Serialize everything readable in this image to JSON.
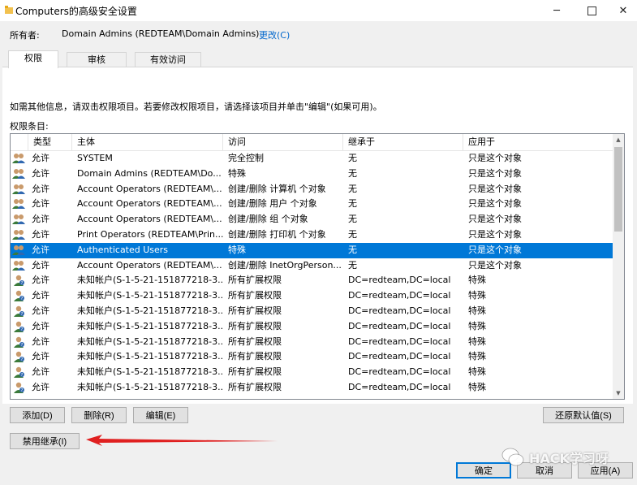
{
  "window": {
    "title": "Computers的高级安全设置",
    "controls": {
      "minimize": "─",
      "close": "✕"
    }
  },
  "owner": {
    "label": "所有者:",
    "value": "Domain Admins (REDTEAM\\Domain Admins)",
    "change_link": "更改(C)"
  },
  "tabs": [
    {
      "label": "权限",
      "active": true
    },
    {
      "label": "审核",
      "active": false
    },
    {
      "label": "有效访问",
      "active": false
    }
  ],
  "instruction": "如需其他信息，请双击权限项目。若要修改权限项目，请选择该项目并单击\"编辑\"(如果可用)。",
  "entries_label": "权限条目:",
  "table": {
    "columns": [
      "类型",
      "主体",
      "访问",
      "继承于",
      "应用于"
    ],
    "rows": [
      {
        "type": "允许",
        "principal": "SYSTEM",
        "access": "完全控制",
        "inherited": "无",
        "applies": "只是这个对象",
        "icon": "group-icon"
      },
      {
        "type": "允许",
        "principal": "Domain Admins (REDTEAM\\Do...",
        "access": "特殊",
        "inherited": "无",
        "applies": "只是这个对象",
        "icon": "group-icon"
      },
      {
        "type": "允许",
        "principal": "Account Operators (REDTEAM\\...",
        "access": "创建/删除 计算机 个对象",
        "inherited": "无",
        "applies": "只是这个对象",
        "icon": "group-icon"
      },
      {
        "type": "允许",
        "principal": "Account Operators (REDTEAM\\...",
        "access": "创建/删除 用户 个对象",
        "inherited": "无",
        "applies": "只是这个对象",
        "icon": "group-icon"
      },
      {
        "type": "允许",
        "principal": "Account Operators (REDTEAM\\...",
        "access": "创建/删除 组 个对象",
        "inherited": "无",
        "applies": "只是这个对象",
        "icon": "group-icon"
      },
      {
        "type": "允许",
        "principal": "Print Operators (REDTEAM\\Prin...",
        "access": "创建/删除 打印机 个对象",
        "inherited": "无",
        "applies": "只是这个对象",
        "icon": "group-icon"
      },
      {
        "type": "允许",
        "principal": "Authenticated Users",
        "access": "特殊",
        "inherited": "无",
        "applies": "只是这个对象",
        "icon": "group-icon",
        "selected": true
      },
      {
        "type": "允许",
        "principal": "Account Operators (REDTEAM\\...",
        "access": "创建/删除 InetOrgPerson...",
        "inherited": "无",
        "applies": "只是这个对象",
        "icon": "group-icon"
      },
      {
        "type": "允许",
        "principal": "未知帐户(S-1-5-21-151877218-3...",
        "access": "所有扩展权限",
        "inherited": "DC=redteam,DC=local",
        "applies": "特殊",
        "icon": "unknown-user-icon"
      },
      {
        "type": "允许",
        "principal": "未知帐户(S-1-5-21-151877218-3...",
        "access": "所有扩展权限",
        "inherited": "DC=redteam,DC=local",
        "applies": "特殊",
        "icon": "unknown-user-icon"
      },
      {
        "type": "允许",
        "principal": "未知帐户(S-1-5-21-151877218-3...",
        "access": "所有扩展权限",
        "inherited": "DC=redteam,DC=local",
        "applies": "特殊",
        "icon": "unknown-user-icon"
      },
      {
        "type": "允许",
        "principal": "未知帐户(S-1-5-21-151877218-3...",
        "access": "所有扩展权限",
        "inherited": "DC=redteam,DC=local",
        "applies": "特殊",
        "icon": "unknown-user-icon"
      },
      {
        "type": "允许",
        "principal": "未知帐户(S-1-5-21-151877218-3...",
        "access": "所有扩展权限",
        "inherited": "DC=redteam,DC=local",
        "applies": "特殊",
        "icon": "unknown-user-icon"
      },
      {
        "type": "允许",
        "principal": "未知帐户(S-1-5-21-151877218-3...",
        "access": "所有扩展权限",
        "inherited": "DC=redteam,DC=local",
        "applies": "特殊",
        "icon": "unknown-user-icon"
      },
      {
        "type": "允许",
        "principal": "未知帐户(S-1-5-21-151877218-3...",
        "access": "所有扩展权限",
        "inherited": "DC=redteam,DC=local",
        "applies": "特殊",
        "icon": "unknown-user-icon"
      },
      {
        "type": "允许",
        "principal": "未知帐户(S-1-5-21-151877218-3...",
        "access": "所有扩展权限",
        "inherited": "DC=redteam,DC=local",
        "applies": "特殊",
        "icon": "unknown-user-icon"
      }
    ]
  },
  "buttons": {
    "add": "添加(D)",
    "remove": "删除(R)",
    "edit": "编辑(E)",
    "restore_defaults": "还原默认值(S)",
    "disable_inheritance": "禁用继承(I)",
    "ok": "确定",
    "cancel": "取消",
    "apply": "应用(A)"
  },
  "watermark": {
    "text": "HACK学习呀"
  },
  "colors": {
    "selection": "#0078d7",
    "link": "#0066cc",
    "annotation_arrow": "#e02020",
    "dialog_bg": "#f0f0f0"
  }
}
